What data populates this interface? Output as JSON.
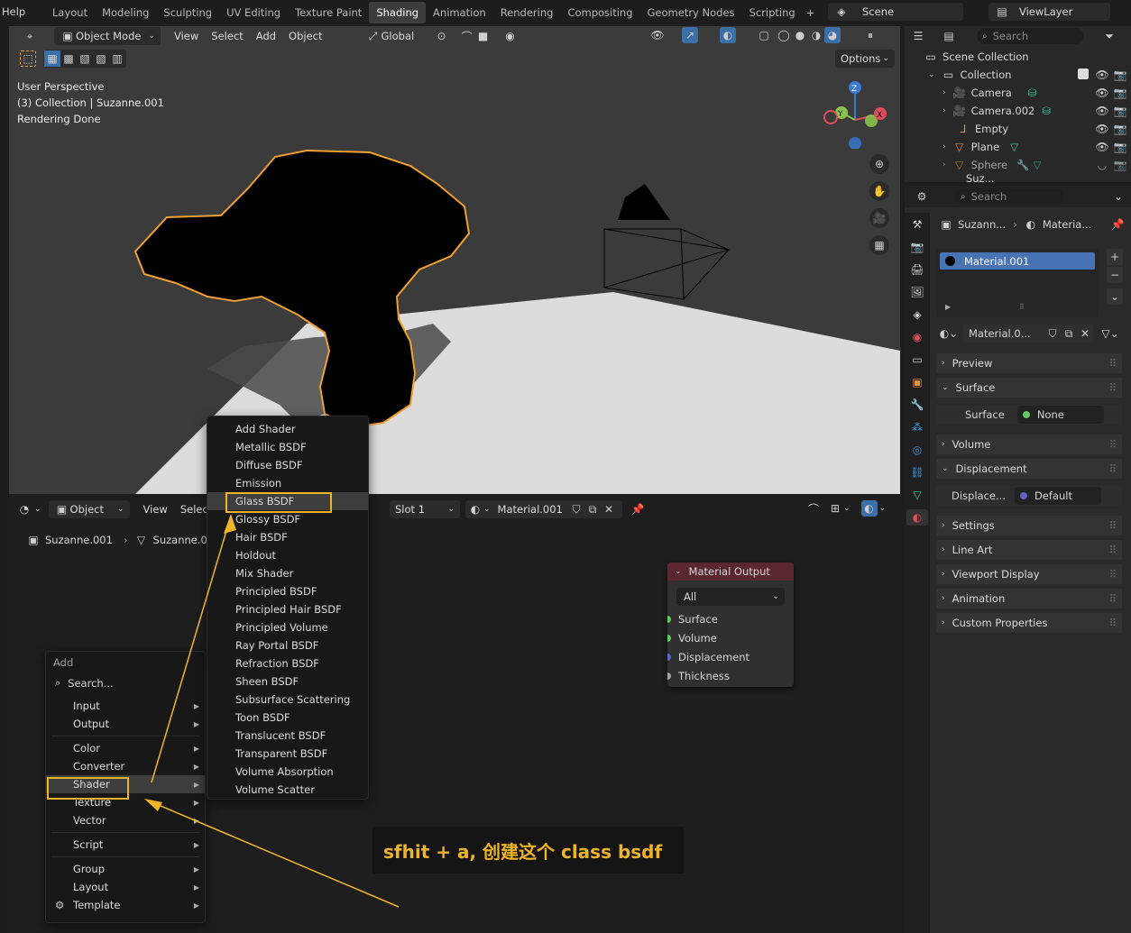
{
  "topbar": {
    "help": "Help",
    "tabs": [
      "Layout",
      "Modeling",
      "Sculpting",
      "UV Editing",
      "Texture Paint",
      "Shading",
      "Animation",
      "Rendering",
      "Compositing",
      "Geometry Nodes",
      "Scripting"
    ],
    "active_tab": "Shading",
    "add_workspace": "+",
    "scene": "Scene",
    "viewlayer": "ViewLayer"
  },
  "viewport": {
    "mode": "Object Mode",
    "menus": [
      "View",
      "Select",
      "Add",
      "Object"
    ],
    "transform": "Global",
    "options": "Options",
    "overlay_text": [
      "User Perspective",
      "(3) Collection | Suzanne.001",
      "Rendering Done"
    ],
    "gizmo": {
      "z": "Z",
      "y": "Y",
      "x": "X"
    }
  },
  "outliner": {
    "search_placeholder": "Search",
    "root": "Scene Collection",
    "collection": "Collection",
    "items": [
      "Camera",
      "Camera.002",
      "Empty",
      "Plane",
      "Sphere",
      "Suz..."
    ]
  },
  "properties": {
    "search_placeholder": "Search",
    "breadcrumb": [
      "Suzann...",
      "Materia..."
    ],
    "slot": "Material.001",
    "material_field": "Material.0...",
    "panels": {
      "preview": "Preview",
      "surface": "Surface",
      "surface_label": "Surface",
      "surface_value": "None",
      "volume": "Volume",
      "displacement": "Displacement",
      "displace_label": "Displace...",
      "displace_value": "Default",
      "settings": "Settings",
      "line_art": "Line Art",
      "viewport_display": "Viewport Display",
      "animation": "Animation",
      "custom_properties": "Custom Properties"
    }
  },
  "node_editor": {
    "type": "Object",
    "menus": [
      "View",
      "Select"
    ],
    "slot": "Slot 1",
    "material": "Material.001",
    "breadcrumb": [
      "Suzanne.001",
      "Suzanne.0"
    ],
    "node": {
      "title": "Material Output",
      "target": "All",
      "sockets": [
        "Surface",
        "Volume",
        "Displacement",
        "Thickness"
      ]
    }
  },
  "add_menu": {
    "title": "Add",
    "search": "Search...",
    "groups": [
      [
        "Input",
        "Output"
      ],
      [
        "Color",
        "Converter",
        "Shader",
        "Texture",
        "Vector"
      ],
      [
        "Script"
      ],
      [
        "Group",
        "Layout",
        "Template"
      ]
    ],
    "highlighted": "Shader"
  },
  "shader_menu": {
    "items": [
      "Add Shader",
      "Metallic BSDF",
      "Diffuse BSDF",
      "Emission",
      "Glass BSDF",
      "Glossy BSDF",
      "Hair BSDF",
      "Holdout",
      "Mix Shader",
      "Principled BSDF",
      "Principled Hair BSDF",
      "Principled Volume",
      "Ray Portal BSDF",
      "Refraction BSDF",
      "Sheen BSDF",
      "Subsurface Scattering",
      "Toon BSDF",
      "Translucent BSDF",
      "Transparent BSDF",
      "Volume Absorption",
      "Volume Scatter"
    ],
    "highlighted": "Glass BSDF"
  },
  "annotation": {
    "text": "sfhit + a, 创建这个 class bsdf",
    "color": "#f0b429"
  }
}
